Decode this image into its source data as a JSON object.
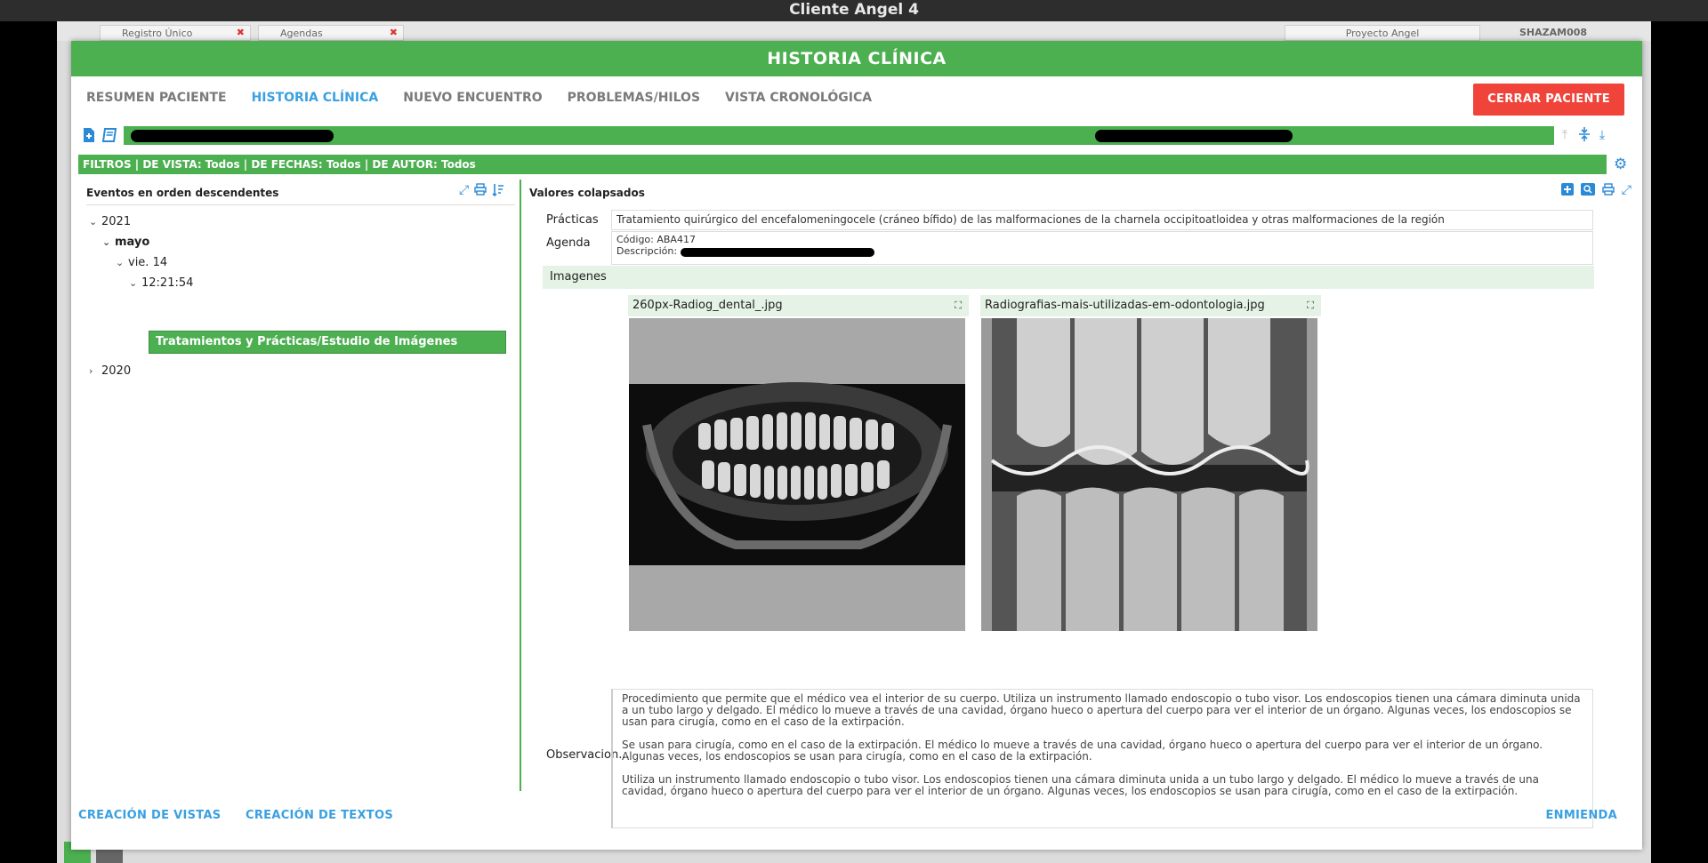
{
  "window": {
    "title": "Cliente Angel 4"
  },
  "backdrop": {
    "tabs": [
      {
        "label": "Registro Único"
      },
      {
        "label": "Agendas"
      }
    ],
    "project_label": "Proyecto Angel",
    "user_label": "SHAZAM008"
  },
  "modal": {
    "title": "HISTORIA CLÍNICA",
    "tabs": [
      {
        "label": "RESUMEN PACIENTE",
        "active": false
      },
      {
        "label": "HISTORIA CLÍNICA",
        "active": true
      },
      {
        "label": "NUEVO ENCUENTRO",
        "active": false
      },
      {
        "label": "PROBLEMAS/HILOS",
        "active": false
      },
      {
        "label": "VISTA CRONOLÓGICA",
        "active": false
      }
    ],
    "close_button": "CERRAR PACIENTE",
    "filters_text": "FILTROS | DE VISTA: Todos | DE FECHAS: Todos | DE AUTOR: Todos"
  },
  "left_panel": {
    "title": "Eventos en orden descendentes",
    "tree": {
      "year_2021": "2021",
      "month": "mayo",
      "day": "vie. 14",
      "time": "12:21:54",
      "leaf": "Tratamientos y Prácticas/Estudio de Imágenes",
      "year_2020": "2020"
    }
  },
  "right_panel": {
    "title": "Valores colapsados",
    "practicas_label": "Prácticas",
    "practicas_value": "Tratamiento quirúrgico del encefalomeningocele (cráneo bífido) de las malformaciones de la charnela occipitoatloidea y otras malformaciones de la región",
    "agenda_label": "Agenda",
    "agenda_codigo": "Código: ABA417",
    "agenda_descripcion": "Descripción:",
    "imagenes_label": "Imagenes",
    "images": [
      {
        "filename": "260px-Radiog_dental_.jpg"
      },
      {
        "filename": "Radiografias-mais-utilizadas-em-odontologia.jpg"
      }
    ],
    "observaciones_label": "Observacion...",
    "observaciones": [
      "Procedimiento que permite que el médico vea el interior de su cuerpo. Utiliza un instrumento llamado endoscopio o tubo visor. Los endoscopios tienen una cámara diminuta unida a un tubo largo y delgado. El médico lo mueve a través de una cavidad, órgano hueco o apertura del cuerpo para ver el interior de un órgano. Algunas veces, los endoscopios se usan para cirugía, como en el caso de la extirpación.",
      "Se usan para cirugía, como en el caso de la extirpación. El médico lo mueve a través de una cavidad, órgano hueco o apertura del cuerpo para ver el interior de un órgano. Algunas veces, los endoscopios se usan para cirugía, como en el caso de la extirpación.",
      "Utiliza un instrumento llamado endoscopio o tubo visor. Los endoscopios tienen una cámara diminuta unida a un tubo largo y delgado. El médico lo mueve a través de una cavidad, órgano hueco o apertura del cuerpo para ver el interior de un órgano. Algunas veces, los endoscopios se usan para cirugía, como en el caso de la extirpación."
    ]
  },
  "footer": {
    "creacion_vistas": "CREACIÓN DE VISTAS",
    "creacion_textos": "CREACIÓN DE TEXTOS",
    "enmienda": "ENMIENDA"
  },
  "colors": {
    "primary_green": "#4caf50",
    "link_blue": "#3aa0e0",
    "close_red": "#f0433a"
  }
}
